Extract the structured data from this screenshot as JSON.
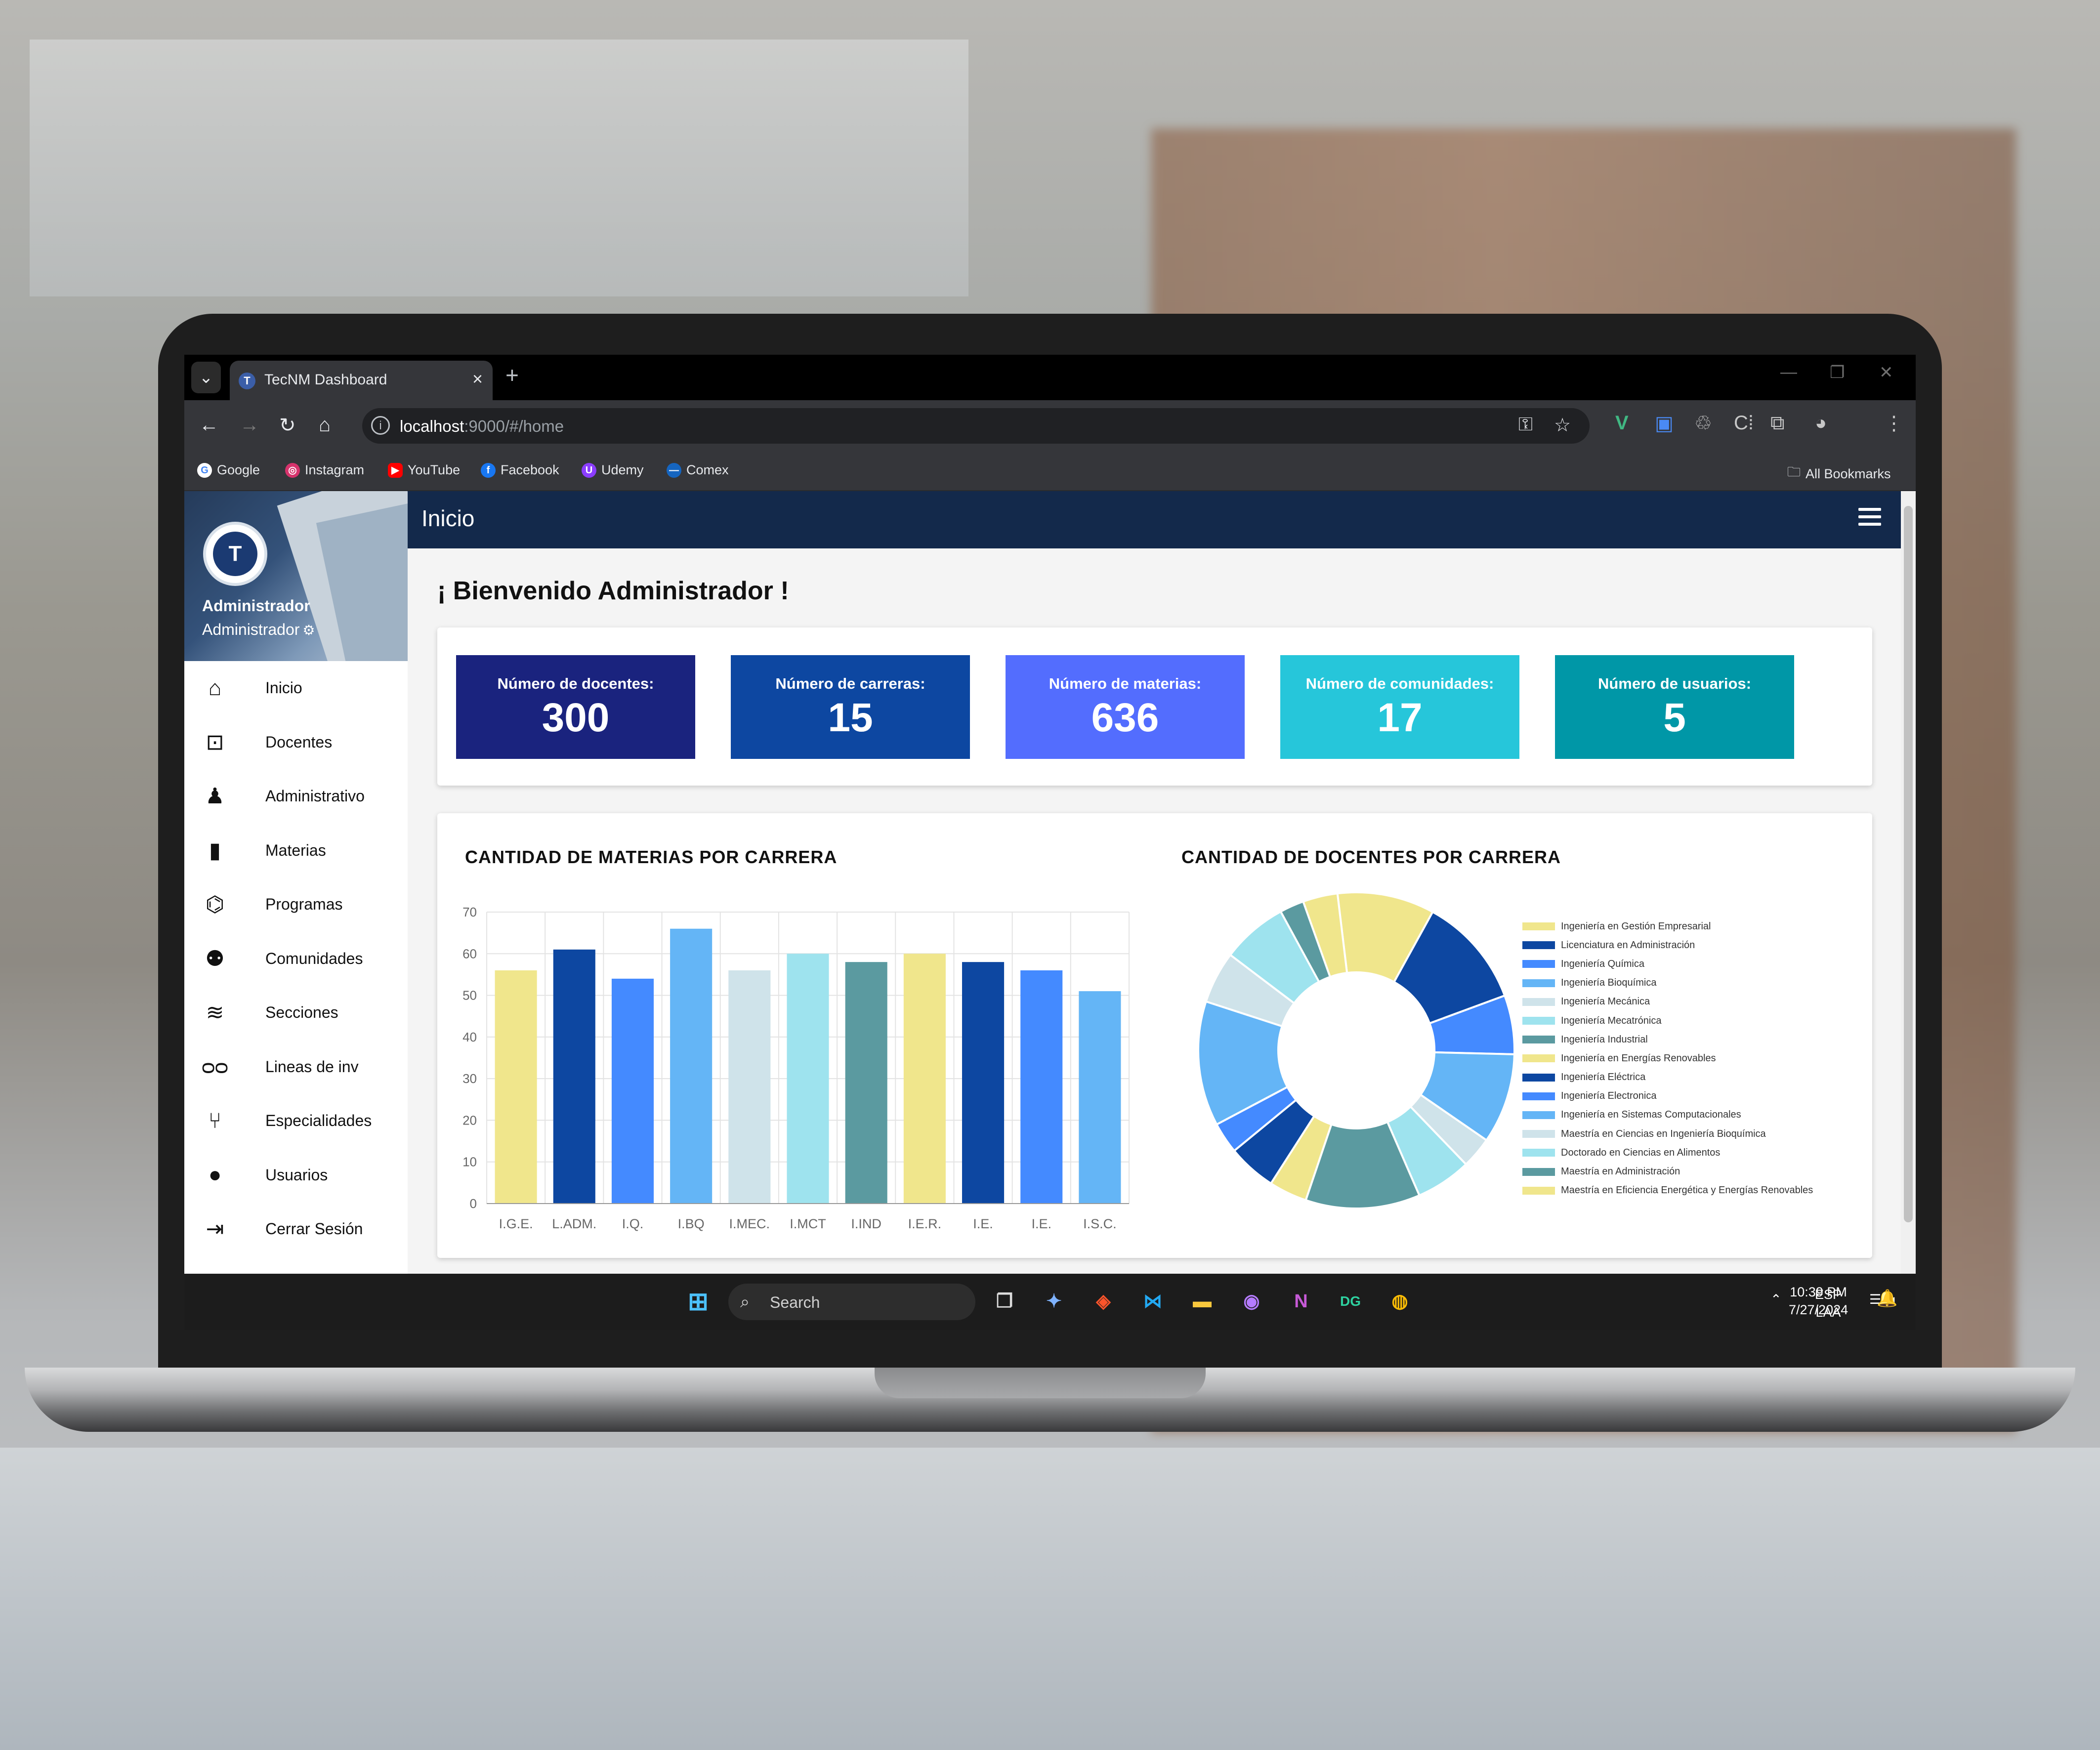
{
  "browser": {
    "tab_title": "TecNM Dashboard",
    "url_host": "localhost",
    "url_path": ":9000/#/home",
    "bookmarks": [
      "Google",
      "Instagram",
      "YouTube",
      "Facebook",
      "Udemy",
      "Comex"
    ],
    "all_bookmarks": "All Bookmarks"
  },
  "profile": {
    "name": "Administrador",
    "role": "Administrador"
  },
  "sidebar": {
    "items": [
      {
        "label": "Inicio",
        "icon": "home-icon",
        "glyph": "⌂"
      },
      {
        "label": "Docentes",
        "icon": "teacher-icon",
        "glyph": "⊡"
      },
      {
        "label": "Administrativo",
        "icon": "admin-icon",
        "glyph": "♟"
      },
      {
        "label": "Materias",
        "icon": "book-icon",
        "glyph": "▮"
      },
      {
        "label": "Programas",
        "icon": "bank-icon",
        "glyph": "⌬"
      },
      {
        "label": "Comunidades",
        "icon": "people-icon",
        "glyph": "⚉"
      },
      {
        "label": "Secciones",
        "icon": "layers-icon",
        "glyph": "≋"
      },
      {
        "label": "Lineas de inv",
        "icon": "glasses-icon",
        "glyph": "ᴑᴑ"
      },
      {
        "label": "Especialidades",
        "icon": "branch-icon",
        "glyph": "⑂"
      },
      {
        "label": "Usuarios",
        "icon": "user-icon",
        "glyph": "●"
      },
      {
        "label": "Cerrar Sesión",
        "icon": "logout-icon",
        "glyph": "⇥"
      }
    ]
  },
  "header": {
    "title": "Inicio"
  },
  "welcome": "¡ Bienvenido Administrador !",
  "stats": [
    {
      "label": "Número de docentes:",
      "value": "300",
      "color": "#1a237e"
    },
    {
      "label": "Número de carreras:",
      "value": "15",
      "color": "#0d47a1"
    },
    {
      "label": "Número de materias:",
      "value": "636",
      "color": "#536dfe"
    },
    {
      "label": "Número de comunidades:",
      "value": "17",
      "color": "#26c6da"
    },
    {
      "label": "Número de usuarios:",
      "value": "5",
      "color": "#0097a7"
    }
  ],
  "chart_data": [
    {
      "type": "bar",
      "title": "CANTIDAD DE MATERIAS POR CARRERA",
      "categories": [
        "I.G.E.",
        "L.ADM.",
        "I.Q.",
        "I.BQ",
        "I.MEC.",
        "I.MCT",
        "I.IND",
        "I.E.R.",
        "I.E.",
        "I.E.",
        "I.S.C."
      ],
      "values": [
        56,
        61,
        54,
        66,
        56,
        60,
        58,
        60,
        58,
        56,
        51
      ],
      "colors": [
        "#f0e68c",
        "#0d47a1",
        "#448aff",
        "#64b5f6",
        "#cfe3ea",
        "#9ee3ee",
        "#5b9aa0",
        "#f0e68c",
        "#0d47a1",
        "#448aff",
        "#64b5f6"
      ],
      "ylim": [
        0,
        70
      ],
      "yticks": [
        0,
        10,
        20,
        30,
        40,
        50,
        60,
        70
      ],
      "grid": true
    },
    {
      "type": "pie",
      "donut": true,
      "title": "CANTIDAD DE DOCENTES POR CARRERA",
      "legend": "right",
      "labels": [
        "Ingeniería en Gestión Empresarial",
        "Licenciatura en Administración",
        "Ingeniería Química",
        "Ingeniería Bioquímica",
        "Ingeniería Mecánica",
        "Ingeniería Mecatrónica",
        "Ingeniería Industrial",
        "Ingeniería en Energías Renovables",
        "Ingeniería Eléctrica",
        "Ingeniería Electronica",
        "Ingeniería en Sistemas Computacionales",
        "Maestría en Ciencias en Ingeniería Bioquímica",
        "Doctorado en Ciencias en Alimentos",
        "Maestría en Administración",
        "Maestría en Eficiencia Energética y Energías Renovables"
      ],
      "values": [
        28,
        32,
        17,
        26,
        9,
        16,
        33,
        11,
        14,
        9,
        36,
        15,
        19,
        7,
        10
      ],
      "colors": [
        "#f0e68c",
        "#0d47a1",
        "#448aff",
        "#64b5f6",
        "#cfe3ea",
        "#9ee3ee",
        "#5b9aa0",
        "#f0e68c",
        "#0d47a1",
        "#448aff",
        "#64b5f6",
        "#cfe3ea",
        "#9ee3ee",
        "#5b9aa0",
        "#f0e68c"
      ]
    }
  ],
  "taskbar": {
    "search": "Search",
    "lang1": "ESP",
    "lang2": "LAA",
    "time": "10:39 PM",
    "date": "7/27/2024"
  }
}
